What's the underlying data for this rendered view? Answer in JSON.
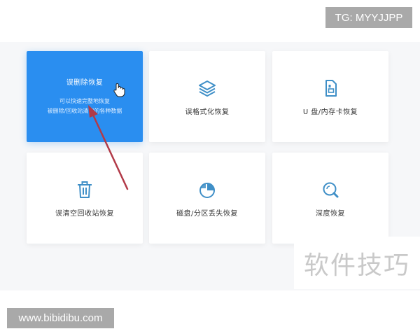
{
  "badges": {
    "tg": "TG: MYYJJPP",
    "site": "www.bibidibu.com"
  },
  "watermark": "软件技巧",
  "cards": [
    {
      "label": "误删除恢复",
      "desc_line1": "可以快速完整地恢复",
      "desc_line2": "被删除/回收站清空的各种数据",
      "active": true
    },
    {
      "label": "误格式化恢复",
      "icon": "layers-icon"
    },
    {
      "label": "U 盘/内存卡恢复",
      "icon": "sd-card-icon"
    },
    {
      "label": "误清空回收站恢复",
      "icon": "trash-icon"
    },
    {
      "label": "磁盘/分区丢失恢复",
      "icon": "pie-chart-icon"
    },
    {
      "label": "深度恢复",
      "icon": "deep-search-icon"
    }
  ],
  "colors": {
    "accent": "#2a8ef0",
    "icon": "#3f8fc7",
    "annotation_arrow": "#b23a48"
  }
}
